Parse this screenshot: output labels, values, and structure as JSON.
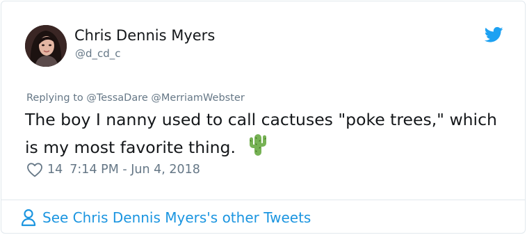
{
  "tweet": {
    "author": {
      "name": "Chris Dennis Myers",
      "handle": "@d_cd_c",
      "avatar_icon": "user-photo-avatar"
    },
    "platform_icon": "twitter-bird-icon",
    "reply": {
      "prefix": "Replying to",
      "mentions": [
        "@TessaDare",
        "@MerriamWebster"
      ]
    },
    "text": "The boy I nanny used to call cactuses \"poke trees,\" which is my most favorite thing.",
    "emoji_icon": "cactus-icon",
    "likes": "14",
    "timestamp": "7:14 PM - Jun 4, 2018",
    "see_more_label": "See Chris Dennis Myers's other Tweets"
  },
  "colors": {
    "text_primary": "#14171a",
    "text_secondary": "#657786",
    "twitter_blue": "#1da1f2",
    "link_blue": "#1b95e0",
    "border": "#e1e8ed"
  }
}
